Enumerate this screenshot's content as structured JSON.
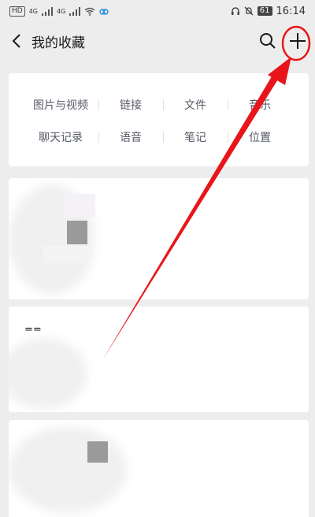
{
  "status_bar": {
    "left_badges": [
      "HD",
      "4G",
      "4G"
    ],
    "battery": "61",
    "time": "16:14"
  },
  "nav": {
    "title": "我的收藏",
    "icons": [
      "back-icon",
      "search-icon",
      "add-icon"
    ]
  },
  "categories": [
    {
      "label": "图片与视频"
    },
    {
      "label": "链接"
    },
    {
      "label": "文件"
    },
    {
      "label": "音乐"
    },
    {
      "label": "聊天记录"
    },
    {
      "label": "语音"
    },
    {
      "label": "笔记"
    },
    {
      "label": "位置"
    }
  ],
  "cards": [
    {
      "kind": "image"
    },
    {
      "kind": "note",
      "text": "=="
    },
    {
      "kind": "image"
    }
  ],
  "colors": {
    "annotation_red": "#e8161a",
    "background": "#ededed"
  }
}
